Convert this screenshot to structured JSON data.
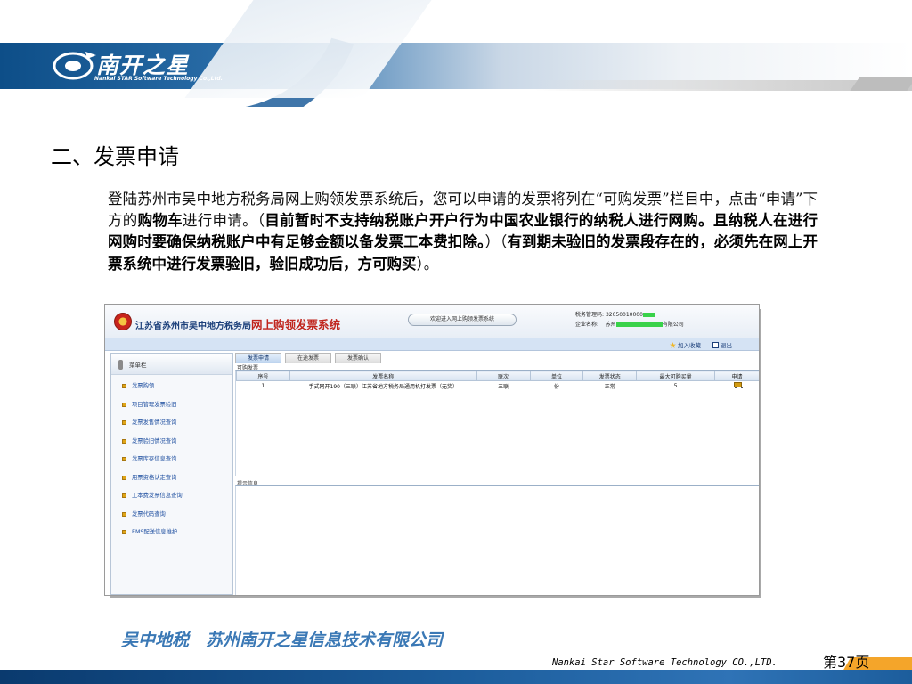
{
  "header": {
    "logo_text": "南开之星",
    "logo_subtext": "Nankai STAR Software Technology Co.,Ltd.",
    "colors": {
      "band_dark": "#0d4e88",
      "band_light": "#eef2f6"
    }
  },
  "title": "二、发票申请",
  "paragraph": {
    "p1": "登陆苏州市吴中地方税务局网上购领发票系统后，您可以申请的发票将列在“可购发票”栏目中，点击“申请”下方的",
    "p1_bold": "购物车",
    "p2": "进行申请。（",
    "p2_bold": "目前暂时不支持纳税账户开户行为中国农业银行的纳税人进行网购。且纳税人在进行网购时要确保纳税账户中有足够金额以备发票工本费扣除。",
    "p3": "）（",
    "p3_bold": "有到期未验旧的发票段存在的，必须先在网上开票系统中进行发票验旧，验旧成功后，方可购买",
    "p4": "）。"
  },
  "app": {
    "title_prefix": "江苏省苏州市吴中地方税务局",
    "title_main": "网上购领发票系统",
    "welcome": "欢迎进入网上购领发票系统",
    "tax_code_label": "税务管理码:",
    "tax_code_value": "32050010000",
    "company_label": "企业名称:",
    "company_prefix": "苏州",
    "company_suffix": "有限公司",
    "toolbar": {
      "favorite": "加入收藏",
      "exit": "退出"
    },
    "sidebar": {
      "header": "菜单栏",
      "items": [
        "发票购领",
        "项目管理发票验旧",
        "发票发售情况查询",
        "发票验旧情况查询",
        "发票库存信息查询",
        "用票资格认定查询",
        "工本费发票信息查询",
        "发票代码查询",
        "EMS配送信息维护"
      ]
    },
    "tabs": [
      "发票申请",
      "在途发票",
      "发票确认"
    ],
    "panel_available": "可购发票",
    "table": {
      "headers": [
        "序号",
        "发票名称",
        "联次",
        "单位",
        "发票状态",
        "最大可购买量",
        "申请"
      ],
      "rows": [
        [
          "1",
          "手式网开190（三联）江苏省地方税务局通用机打发票（无奖）",
          "三联",
          "份",
          "正常",
          "5"
        ]
      ]
    },
    "panel_hint": "提示信息"
  },
  "footer": {
    "company": "吴中地税　苏州南开之星信息技术有限公司",
    "english": "Nankai Star Software Technology CO.,LTD.",
    "page": "第37页"
  }
}
